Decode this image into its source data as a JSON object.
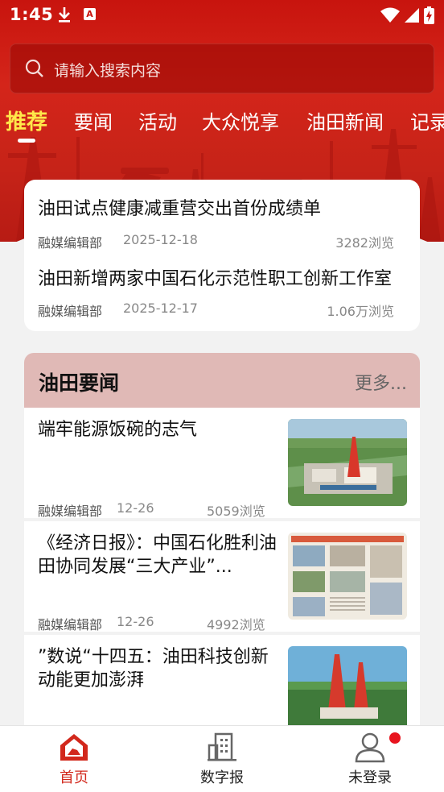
{
  "status_bar": {
    "time": "1:45",
    "badge_letter": "A"
  },
  "search": {
    "placeholder": "请输入搜索内容"
  },
  "tabs": [
    {
      "label": "推荐",
      "active": true
    },
    {
      "label": "要闻"
    },
    {
      "label": "活动"
    },
    {
      "label": "大众悦享"
    },
    {
      "label": "油田新闻"
    },
    {
      "label": "记录"
    }
  ],
  "top_news": [
    {
      "title": "油田试点健康减重营交出首份成绩单",
      "source": "融媒编辑部",
      "date": "2025-12-18",
      "views": "3282浏览"
    },
    {
      "title": "油田新增两家中国石化示范性职工创新工作室",
      "source": "融媒编辑部",
      "date": "2025-12-17",
      "views": "1.06万浏览"
    }
  ],
  "section": {
    "title": "油田要闻",
    "more": "更多..."
  },
  "news_list": [
    {
      "title": "端牢能源饭碗的志气",
      "source": "融媒编辑部",
      "date": "12-26",
      "views": "5059浏览",
      "thumb": "oilfield-aerial"
    },
    {
      "title": "《经济日报》：中国石化胜利油田协同发展“三大产业”...",
      "source": "融媒编辑部",
      "date": "12-26",
      "views": "4992浏览",
      "thumb": "newspaper-page"
    },
    {
      "title": "”数说“十四五：油田科技创新动能更加澎湃",
      "source": "",
      "date": "",
      "views": "",
      "thumb": "drilling-rig"
    }
  ],
  "bottom_nav": [
    {
      "label": "首页",
      "icon": "home-icon",
      "active": true
    },
    {
      "label": "数字报",
      "icon": "building-icon"
    },
    {
      "label": "未登录",
      "icon": "user-icon",
      "badge": true
    }
  ],
  "colors": {
    "brand_red": "#c8140e",
    "active_tab": "#ffe74a",
    "section_bg": "#e0b9b6",
    "nav_active": "#d2281c"
  }
}
